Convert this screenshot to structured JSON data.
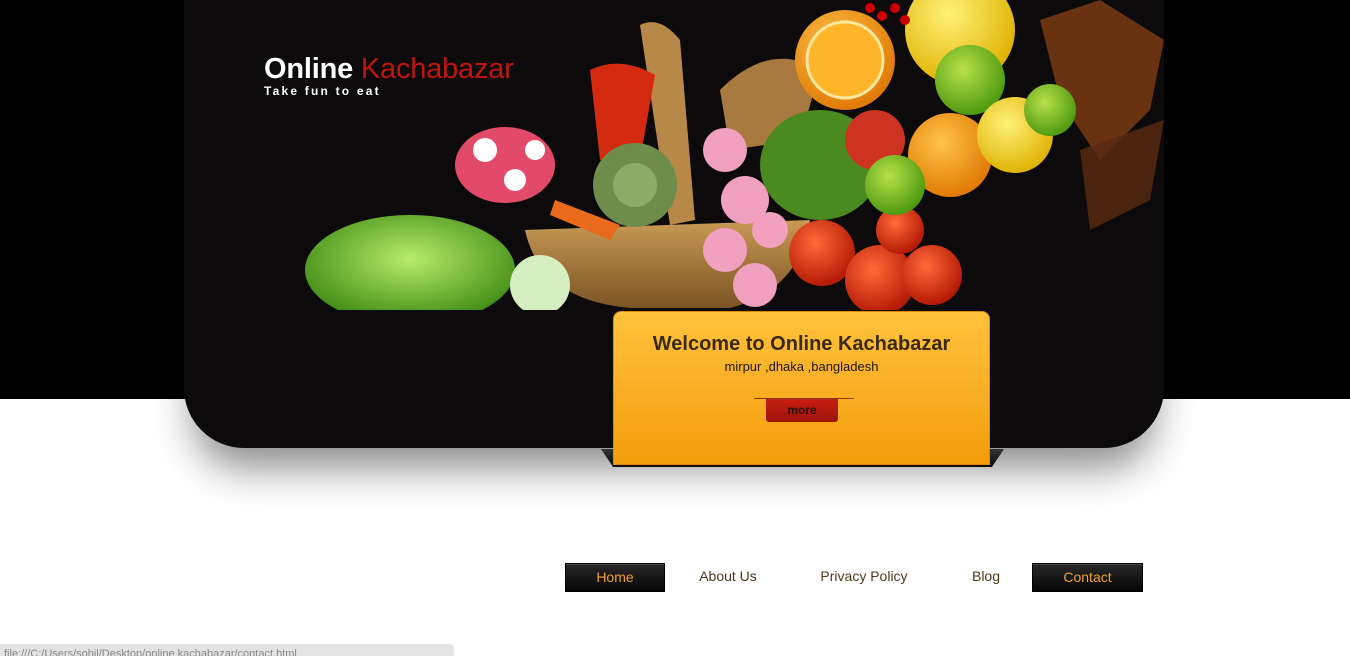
{
  "logo": {
    "word1": "Online",
    "word2": "Kachabazar",
    "tagline": "Take fun to eat"
  },
  "welcome": {
    "title": "Welcome to Online Kachabazar",
    "subtitle": "mirpur ,dhaka ,bangladesh",
    "more_label": "more"
  },
  "nav": {
    "items": [
      {
        "label": "Home"
      },
      {
        "label": "About Us"
      },
      {
        "label": "Privacy Policy"
      },
      {
        "label": "Blog"
      },
      {
        "label": "Contact"
      }
    ]
  },
  "status_bar": {
    "text": "file:///C:/Users/sohil/Desktop/online kachabazar/contact.html"
  },
  "colors": {
    "accent_red": "#c0150c",
    "welcome_orange": "#f8ad22",
    "nav_text_active": "#f0a22a",
    "background_dark": "#0c0a0b"
  },
  "icons": [
    "vegetable-basket-banner"
  ]
}
